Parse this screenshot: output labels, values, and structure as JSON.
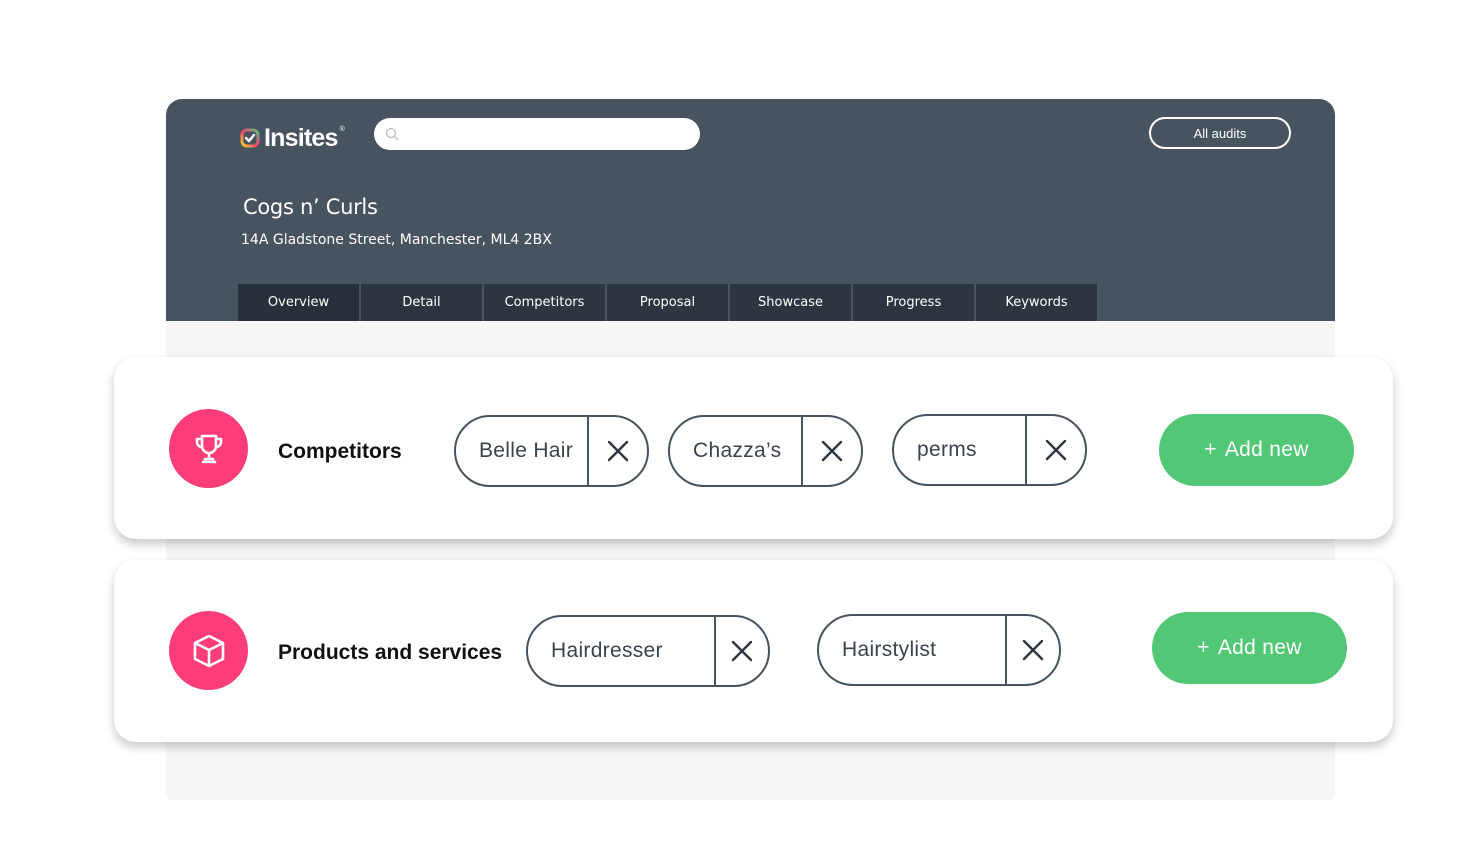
{
  "header": {
    "logo_text": "Insites",
    "logo_reg": "®",
    "search_placeholder": "",
    "all_audits_label": "All audits",
    "business_name": "Cogs n’ Curls",
    "business_address": "14A Gladstone Street, Manchester, ML4 2BX"
  },
  "tabs": [
    {
      "label": "Overview"
    },
    {
      "label": "Detail"
    },
    {
      "label": "Competitors"
    },
    {
      "label": "Proposal"
    },
    {
      "label": "Showcase"
    },
    {
      "label": "Progress"
    },
    {
      "label": "Keywords"
    }
  ],
  "competitors": {
    "title": "Competitors",
    "icon": "trophy-icon",
    "chips": [
      {
        "label": "Belle Hair"
      },
      {
        "label": "Chazza’s"
      },
      {
        "label": "perms"
      }
    ],
    "add_plus": "+",
    "add_label": "Add new"
  },
  "products": {
    "title": "Products and services",
    "icon": "box-icon",
    "chips": [
      {
        "label": "Hairdresser"
      },
      {
        "label": "Hairstylist"
      }
    ],
    "add_plus": "+",
    "add_label": "Add new"
  },
  "colors": {
    "header_bg": "#47535f",
    "tab_bg": "#2d3640",
    "accent_pink": "#fd3d79",
    "accent_green": "#52c876"
  }
}
